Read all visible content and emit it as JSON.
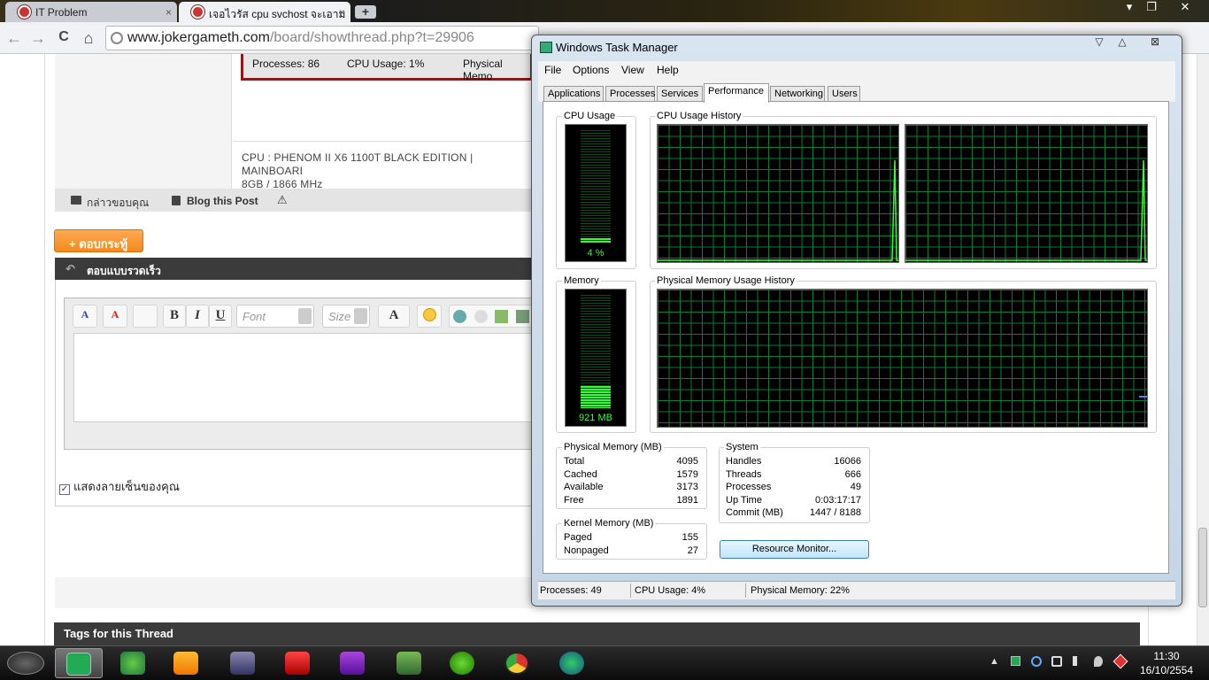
{
  "browser": {
    "tabs": [
      {
        "label": "IT Problem",
        "close": "×"
      },
      {
        "label": "เจอไวรัส cpu svchost จะเอาม",
        "close": "×"
      }
    ],
    "new_tab": "+",
    "url_host": "www.jokergameth.com",
    "url_path": "/board/showthread.php?t=29906",
    "window_controls": {
      "minimize": "▾",
      "restore": "❐",
      "close": "✕"
    },
    "nav": {
      "back": "←",
      "forward": "→",
      "reload": "C",
      "home": "⌂"
    }
  },
  "page": {
    "status_strip": {
      "processes": "Processes: 86",
      "cpu": "CPU Usage: 1%",
      "memory": "Physical Memo"
    },
    "signature_line1": "CPU : PHENOM II X6 1100T BLACK EDITION | MAINBOARI",
    "signature_line2": "8GB / 1866 MHz",
    "post_actions": {
      "thanks": "กล่าวขอบคุณ",
      "blog": "Blog this Post",
      "report": "⚠"
    },
    "reply_button": "+ ตอบกระทู้",
    "quick_reply_title": "ตอบแบบรวดเร็ว",
    "editor": {
      "font_placeholder": "Font",
      "size_placeholder": "Size",
      "bold": "B",
      "italic": "I",
      "underline": "U",
      "text_color": "A"
    },
    "show_signature_label": "แสดงลายเซ็นของคุณ",
    "show_signature_checked": "✓",
    "tags_title": "Tags for this Thread"
  },
  "task_manager": {
    "title": "Windows Task Manager",
    "menu": [
      "File",
      "Options",
      "View",
      "Help"
    ],
    "tabs": [
      "Applications",
      "Processes",
      "Services",
      "Performance",
      "Networking",
      "Users"
    ],
    "active_tab": "Performance",
    "cpu_usage": {
      "label": "CPU Usage",
      "value": "4 %",
      "fraction": 0.04
    },
    "cpu_history_label": "CPU Usage History",
    "memory": {
      "label": "Memory",
      "value": "921 MB",
      "fraction": 0.22
    },
    "memory_history_label": "Physical Memory Usage History",
    "physical_memory": {
      "label": "Physical Memory (MB)",
      "rows": [
        {
          "name": "Total",
          "value": "4095"
        },
        {
          "name": "Cached",
          "value": "1579"
        },
        {
          "name": "Available",
          "value": "3173"
        },
        {
          "name": "Free",
          "value": "1891"
        }
      ]
    },
    "kernel_memory": {
      "label": "Kernel Memory (MB)",
      "rows": [
        {
          "name": "Paged",
          "value": "155"
        },
        {
          "name": "Nonpaged",
          "value": "27"
        }
      ]
    },
    "system": {
      "label": "System",
      "rows": [
        {
          "name": "Handles",
          "value": "16066"
        },
        {
          "name": "Threads",
          "value": "666"
        },
        {
          "name": "Processes",
          "value": "49"
        },
        {
          "name": "Up Time",
          "value": "0:03:17:17"
        },
        {
          "name": "Commit (MB)",
          "value": "1447 / 8188"
        }
      ]
    },
    "resource_monitor_button": "Resource Monitor...",
    "status": {
      "processes": "Processes: 49",
      "cpu": "CPU Usage: 4%",
      "memory": "Physical Memory: 22%"
    },
    "window_controls": {
      "minimize": "▽",
      "maximize": "△",
      "close": "⊠"
    }
  },
  "taskbar": {
    "clock_time": "11:30",
    "clock_date": "16/10/2554",
    "tray_expand": "▲"
  },
  "colors": {
    "meter_green": "#33ff33",
    "grid_green": "#0a7d36",
    "reply_orange": "#f58a1f"
  }
}
